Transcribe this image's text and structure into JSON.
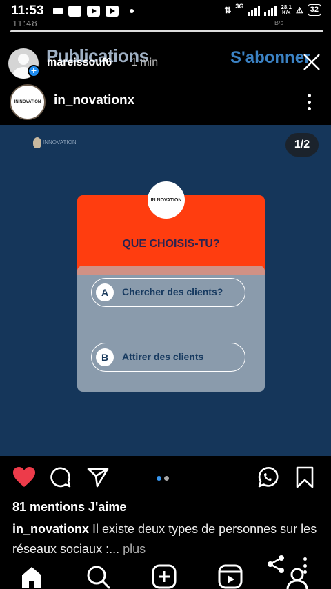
{
  "status_bar": {
    "time": "11:53",
    "network": "3G",
    "speed_value": "28,1",
    "speed_unit": "K/s",
    "battery": "32"
  },
  "ghost": {
    "time": "11:48",
    "speed_unit": "B/s"
  },
  "story": {
    "title": "Publications",
    "username": "mareissouf6",
    "time_ago": "1 min",
    "subscribe": "S'abonner"
  },
  "post": {
    "username": "in_novationx",
    "avatar_text": "IN NOVATION",
    "page_counter": "1/2",
    "image": {
      "watermark": "INNOVATION",
      "logo_text": "IN NOVATION",
      "question": "QUE CHOISIS-TU?",
      "options": [
        {
          "letter": "A",
          "text": "Chercher des clients?"
        },
        {
          "letter": "B",
          "text": "Attirer des clients"
        }
      ]
    },
    "likes": "81 mentions J'aime",
    "caption_user": "in_novationx",
    "caption_text": " Il existe deux types de personnes sur les réseaux sociaux :...",
    "caption_more": " plus"
  },
  "icons": {
    "like": "heart-icon",
    "comment": "comment-icon",
    "share": "send-icon",
    "whatsapp": "whatsapp-icon",
    "save": "bookmark-icon",
    "nav": [
      "home-icon",
      "search-icon",
      "add-icon",
      "reels-icon",
      "profile-icon"
    ]
  },
  "colors": {
    "like": "#ed3b4a",
    "dot_active": "#3897f0",
    "dot_inactive": "#a8a8a8",
    "subscribe": "#3b82c4",
    "post_bg": "#15365a",
    "quiz_top": "#ff3d0f"
  }
}
